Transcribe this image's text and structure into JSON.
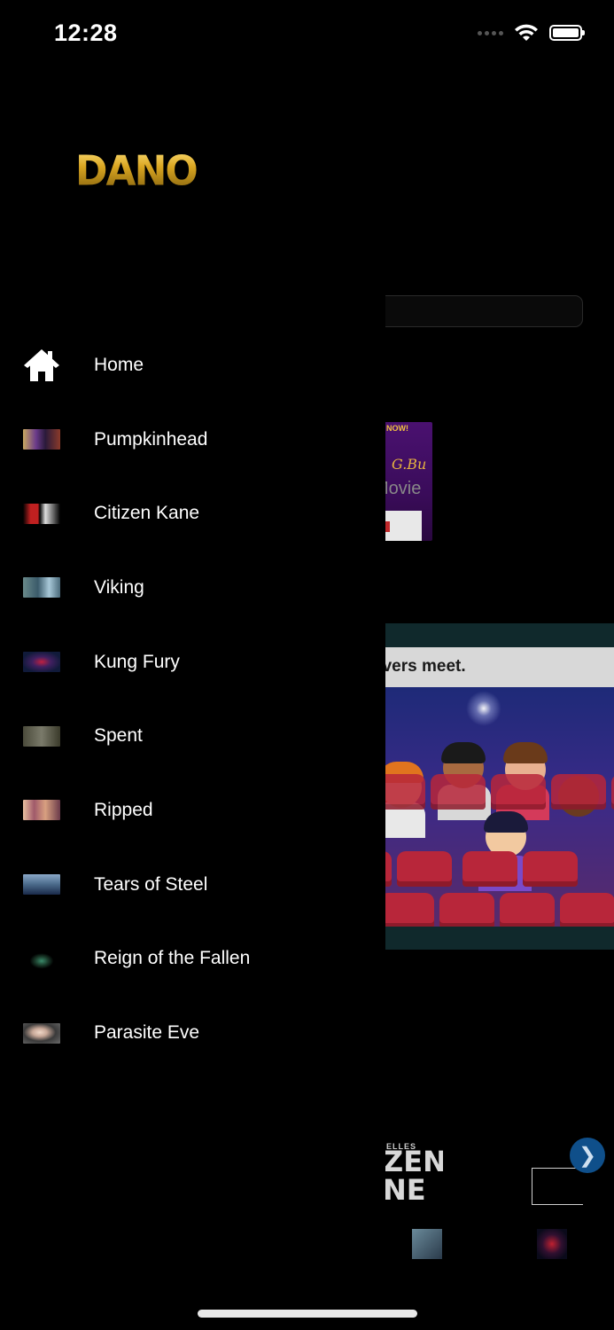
{
  "status_bar": {
    "time": "12:28",
    "icons": [
      "cellular-signal-icon",
      "wifi-icon",
      "battery-icon"
    ]
  },
  "drawer": {
    "logo_text": "DANO",
    "items": [
      {
        "label": "Home",
        "icon": "home-icon"
      },
      {
        "label": "Pumpkinhead",
        "icon": "pumpkinhead-thumbnail"
      },
      {
        "label": "Citizen Kane",
        "icon": "citizen-kane-thumbnail"
      },
      {
        "label": "Viking",
        "icon": "viking-thumbnail"
      },
      {
        "label": "Kung Fury",
        "icon": "kung-fury-thumbnail"
      },
      {
        "label": "Spent",
        "icon": "spent-thumbnail"
      },
      {
        "label": "Ripped",
        "icon": "ripped-thumbnail"
      },
      {
        "label": "Tears of Steel",
        "icon": "tears-of-steel-thumbnail"
      },
      {
        "label": "Reign of the Fallen",
        "icon": "reign-of-the-fallen-thumbnail"
      },
      {
        "label": "Parasite Eve",
        "icon": "parasite-eve-thumbnail"
      }
    ]
  },
  "background": {
    "poster_top_text": "NOW!",
    "poster_script_text": "G.Bu",
    "movie_label": "Movie",
    "promo_text": "overs meet.",
    "citizen_small_text": "ELLES",
    "citizen_big_text": "ZEN\nNE",
    "carousel_next_glyph": "❯"
  },
  "colors": {
    "background": "#000000",
    "accent_blue": "#0f4f8a",
    "logo_gold": "#d9a520"
  }
}
